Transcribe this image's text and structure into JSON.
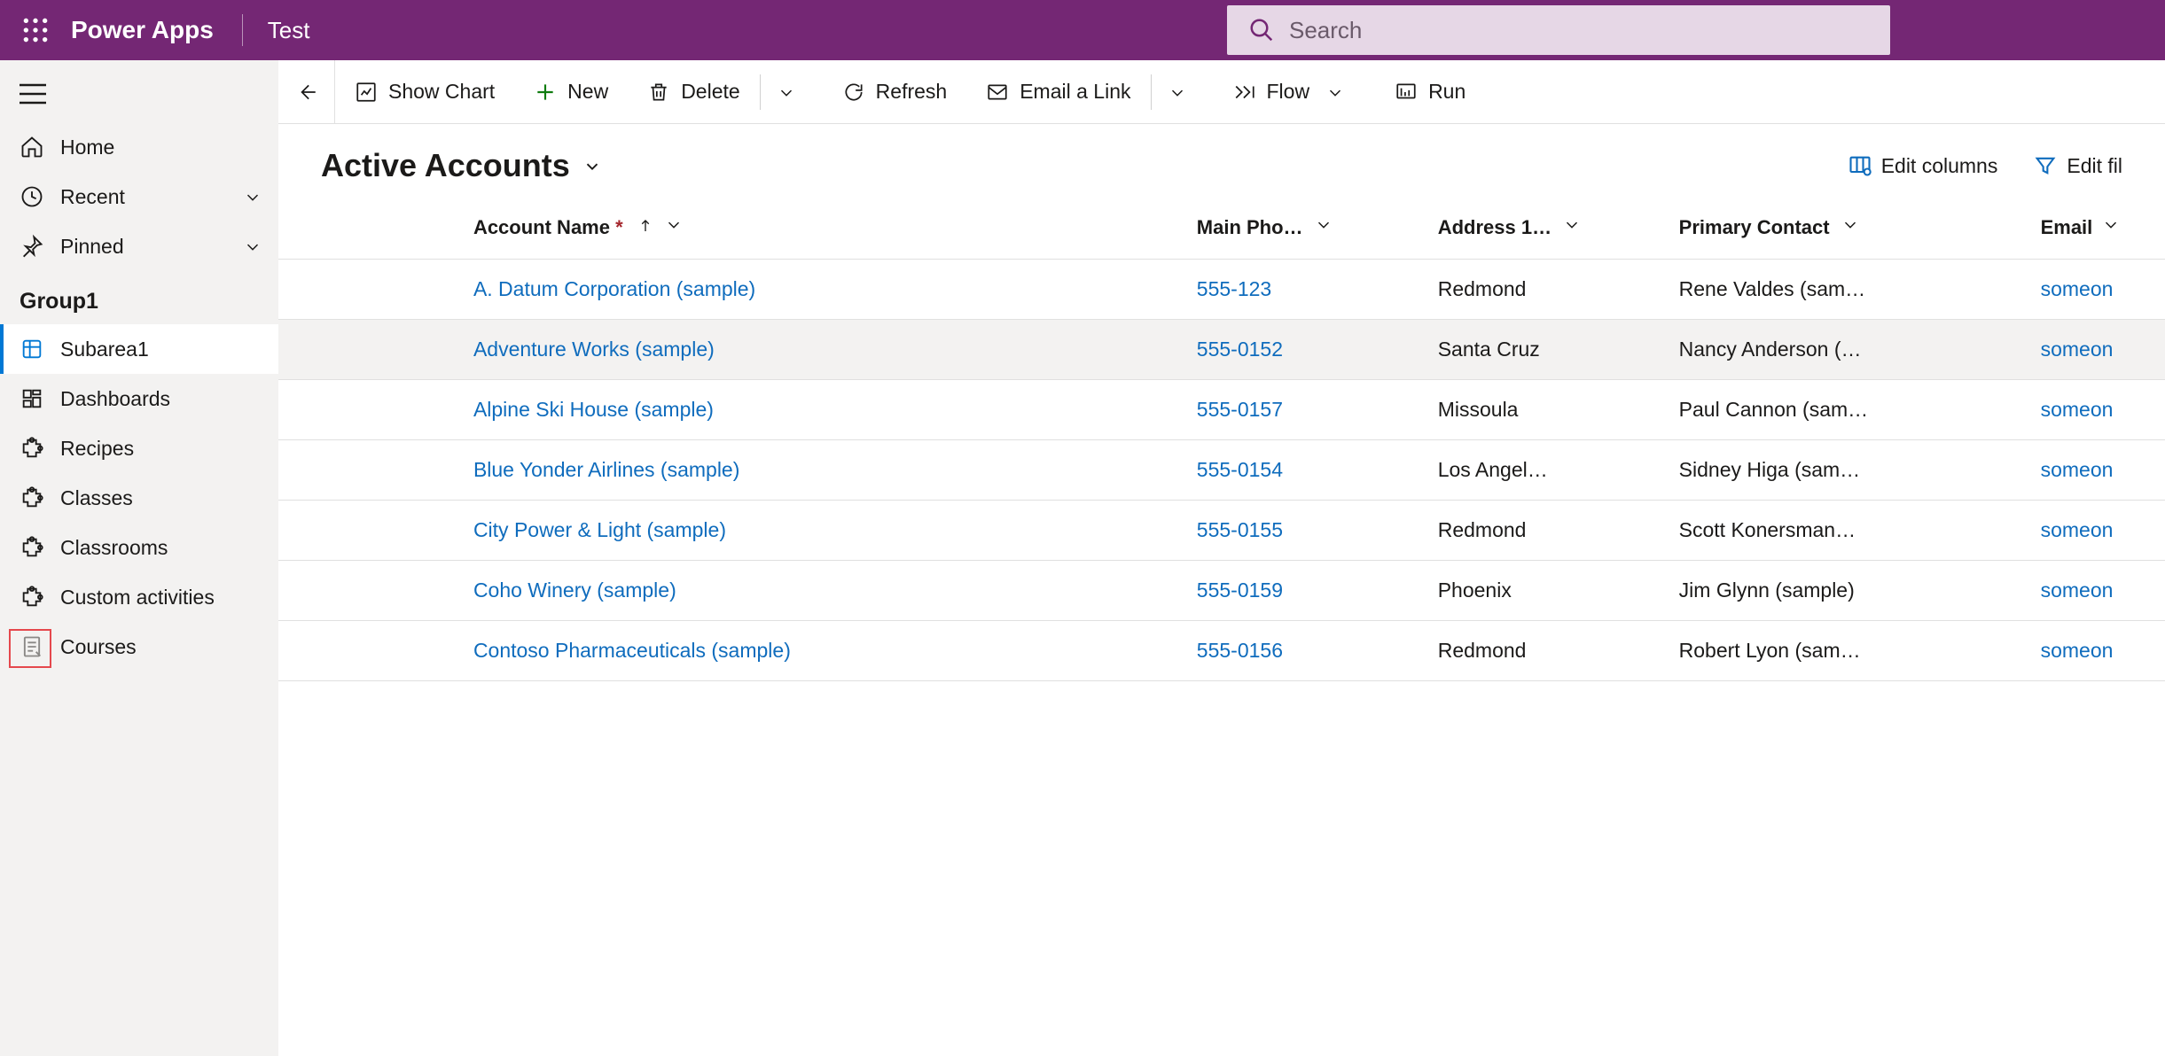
{
  "topbar": {
    "brand": "Power Apps",
    "env": "Test",
    "search_placeholder": "Search"
  },
  "nav": {
    "home": "Home",
    "recent": "Recent",
    "pinned": "Pinned",
    "group1": "Group1",
    "items": [
      "Subarea1",
      "Dashboards",
      "Recipes",
      "Classes",
      "Classrooms",
      "Custom activities",
      "Courses"
    ]
  },
  "commands": {
    "show_chart": "Show Chart",
    "new": "New",
    "delete": "Delete",
    "refresh": "Refresh",
    "email_link": "Email a Link",
    "flow": "Flow",
    "run": "Run"
  },
  "view": {
    "title": "Active Accounts",
    "edit_columns": "Edit columns",
    "edit_filters": "Edit fil"
  },
  "columns": {
    "account": "Account Name",
    "phone": "Main Pho…",
    "addr": "Address 1…",
    "contact": "Primary Contact",
    "email": "Email"
  },
  "rows": [
    {
      "name": "A. Datum Corporation (sample)",
      "phone": "555-123",
      "addr": "Redmond",
      "contact": "Rene Valdes (sam…",
      "email": "someon"
    },
    {
      "name": "Adventure Works (sample)",
      "phone": "555-0152",
      "addr": "Santa Cruz",
      "contact": "Nancy Anderson (…",
      "email": "someon"
    },
    {
      "name": "Alpine Ski House (sample)",
      "phone": "555-0157",
      "addr": "Missoula",
      "contact": "Paul Cannon (sam…",
      "email": "someon"
    },
    {
      "name": "Blue Yonder Airlines (sample)",
      "phone": "555-0154",
      "addr": "Los Angel…",
      "contact": "Sidney Higa (sam…",
      "email": "someon"
    },
    {
      "name": "City Power & Light (sample)",
      "phone": "555-0155",
      "addr": "Redmond",
      "contact": "Scott Konersman…",
      "email": "someon"
    },
    {
      "name": "Coho Winery (sample)",
      "phone": "555-0159",
      "addr": "Phoenix",
      "contact": "Jim Glynn (sample)",
      "email": "someon"
    },
    {
      "name": "Contoso Pharmaceuticals (sample)",
      "phone": "555-0156",
      "addr": "Redmond",
      "contact": "Robert Lyon (sam…",
      "email": "someon"
    }
  ]
}
